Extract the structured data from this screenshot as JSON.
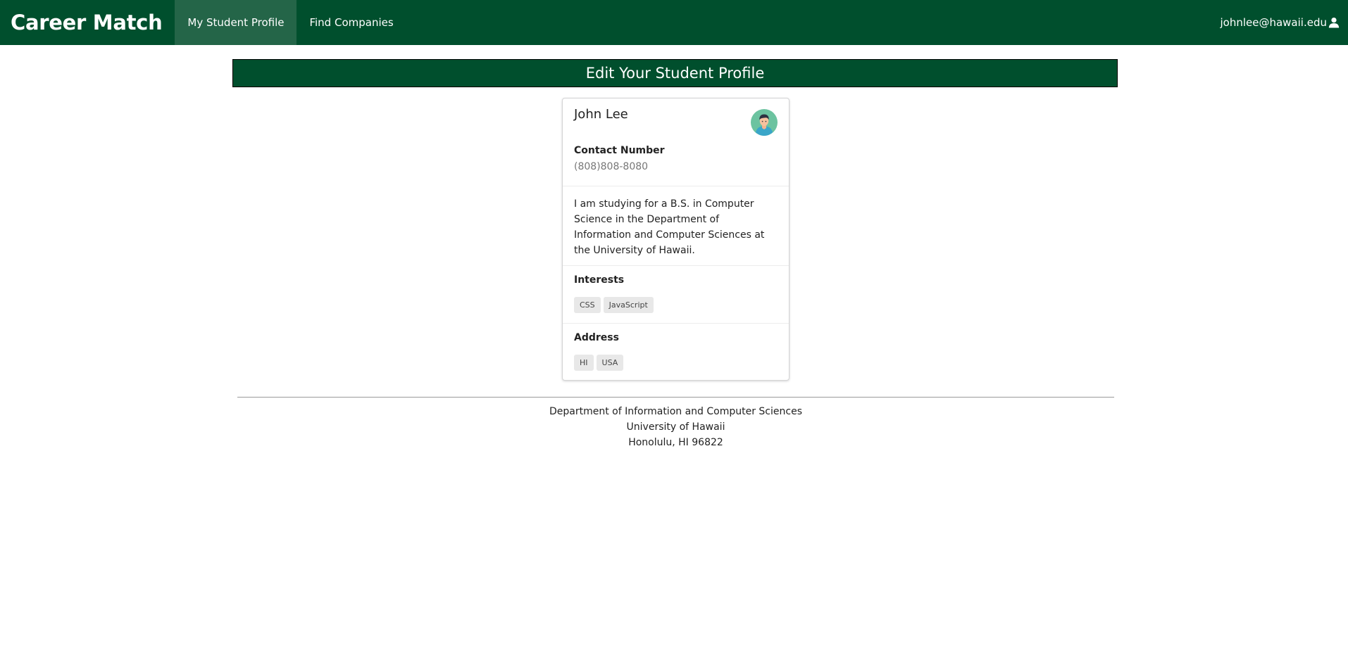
{
  "navbar": {
    "brand": "Career Match",
    "items": [
      {
        "label": "My Student Profile",
        "active": true
      },
      {
        "label": "Find Companies",
        "active": false
      }
    ],
    "user_email": "johnlee@hawaii.edu",
    "user_icon": "user-icon"
  },
  "banner": {
    "title": "Edit Your Student Profile"
  },
  "profile": {
    "name": "John Lee",
    "avatar_icon": "student-avatar",
    "contact_label": "Contact Number",
    "contact_value": "(808)808-8080",
    "description": "I am studying for a B.S. in Computer Science in the Department of Information and Computer Sciences at the University of Hawaii.",
    "interests_label": "Interests",
    "interests": [
      "CSS",
      "JavaScript"
    ],
    "address_label": "Address",
    "address": [
      "HI",
      "USA"
    ]
  },
  "footer": {
    "line1": "Department of Information and Computer Sciences",
    "line2": "University of Hawaii",
    "line3": "Honolulu, HI 96822"
  },
  "colors": {
    "primary": "#004f2d",
    "nav_active": "#246548"
  }
}
